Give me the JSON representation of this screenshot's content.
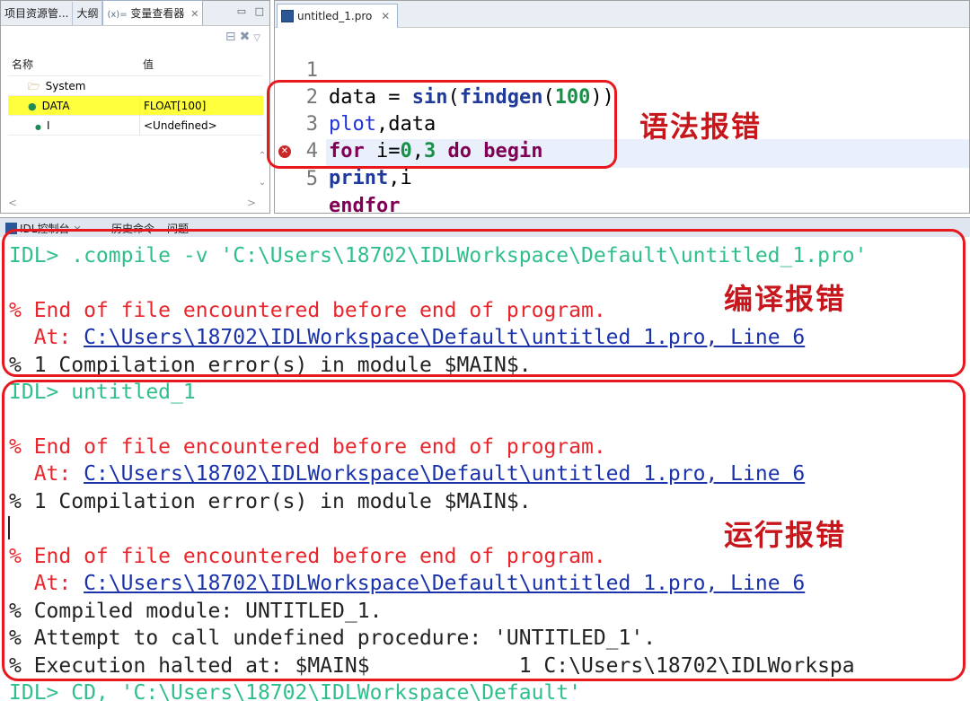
{
  "left_panel": {
    "tabs": [
      "项目资源管...",
      "大纲",
      "变量查看器"
    ],
    "active_tab_index": 2,
    "active_tab_prefix": "(x)=",
    "close_glyph": "✕",
    "window_controls": "▭ □",
    "toolbar_icons": [
      "collapse-all-icon",
      "remove-icon",
      "view-menu-icon"
    ],
    "columns": [
      "名称",
      "值"
    ],
    "rows": [
      {
        "name": "System",
        "value": "",
        "icon": "folder-icon"
      },
      {
        "name": "DATA",
        "value": "FLOAT[100]",
        "icon": "variable-icon",
        "selected": true
      },
      {
        "name": "I",
        "value": "<Undefined>",
        "icon": "dot-icon"
      }
    ],
    "hscroll_left": "<",
    "hscroll_right": ">"
  },
  "editor": {
    "tab_label": "untitled_1.pro",
    "lines": [
      {
        "n": "1",
        "text": "data = sin(findgen(100))"
      },
      {
        "n": "2",
        "text": "plot,data"
      },
      {
        "n": "3",
        "text": "for i=0,3 do begin"
      },
      {
        "n": "4",
        "text": "print,i"
      },
      {
        "n": "5",
        "text": "endfor"
      }
    ],
    "error_line": "5",
    "hscroll_left": "<"
  },
  "annotations": {
    "syntax_error": "语法报错",
    "compile_error": "编译报错",
    "runtime_error": "运行报错"
  },
  "console": {
    "tabs": [
      "IDL控制台",
      "历史命令",
      "问题"
    ],
    "lines": [
      {
        "kind": "prompt",
        "text": "IDL> .compile -v 'C:\\Users\\18702\\IDLWorkspace\\Default\\untitled_1.pro'"
      },
      {
        "kind": "blank",
        "text": ""
      },
      {
        "kind": "error",
        "text": "% End of file encountered before end of program."
      },
      {
        "kind": "at",
        "prefix": "  At: ",
        "link": "C:\\Users\\18702\\IDLWorkspace\\Default\\untitled 1.pro, Line 6"
      },
      {
        "kind": "info",
        "text": "% 1 Compilation error(s) in module $MAIN$."
      },
      {
        "kind": "prompt",
        "text": "IDL> untitled_1"
      },
      {
        "kind": "blank",
        "text": ""
      },
      {
        "kind": "error",
        "text": "% End of file encountered before end of program."
      },
      {
        "kind": "at",
        "prefix": "  At: ",
        "link": "C:\\Users\\18702\\IDLWorkspace\\Default\\untitled 1.pro, Line 6"
      },
      {
        "kind": "info",
        "text": "% 1 Compilation error(s) in module $MAIN$."
      },
      {
        "kind": "blank",
        "text": ""
      },
      {
        "kind": "error",
        "text": "% End of file encountered before end of program."
      },
      {
        "kind": "at",
        "prefix": "  At: ",
        "link": "C:\\Users\\18702\\IDLWorkspace\\Default\\untitled 1.pro, Line 6"
      },
      {
        "kind": "info",
        "text": "% Compiled module: UNTITLED_1."
      },
      {
        "kind": "info",
        "text": "% Attempt to call undefined procedure: 'UNTITLED_1'."
      },
      {
        "kind": "info",
        "text": "% Execution halted at: $MAIN$            1 C:\\Users\\18702\\IDLWorkspa"
      },
      {
        "kind": "prompt",
        "text": "IDL> CD, 'C:\\Users\\18702\\IDLWorkspace\\Default'"
      }
    ]
  },
  "colors": {
    "annotation_red": "#e8181f",
    "prompt_green": "#2fbf8a",
    "error_red": "#e8262c",
    "link_blue": "#1b33aa",
    "keyword": "#7f0055",
    "selected_row": "#ffff3c"
  }
}
